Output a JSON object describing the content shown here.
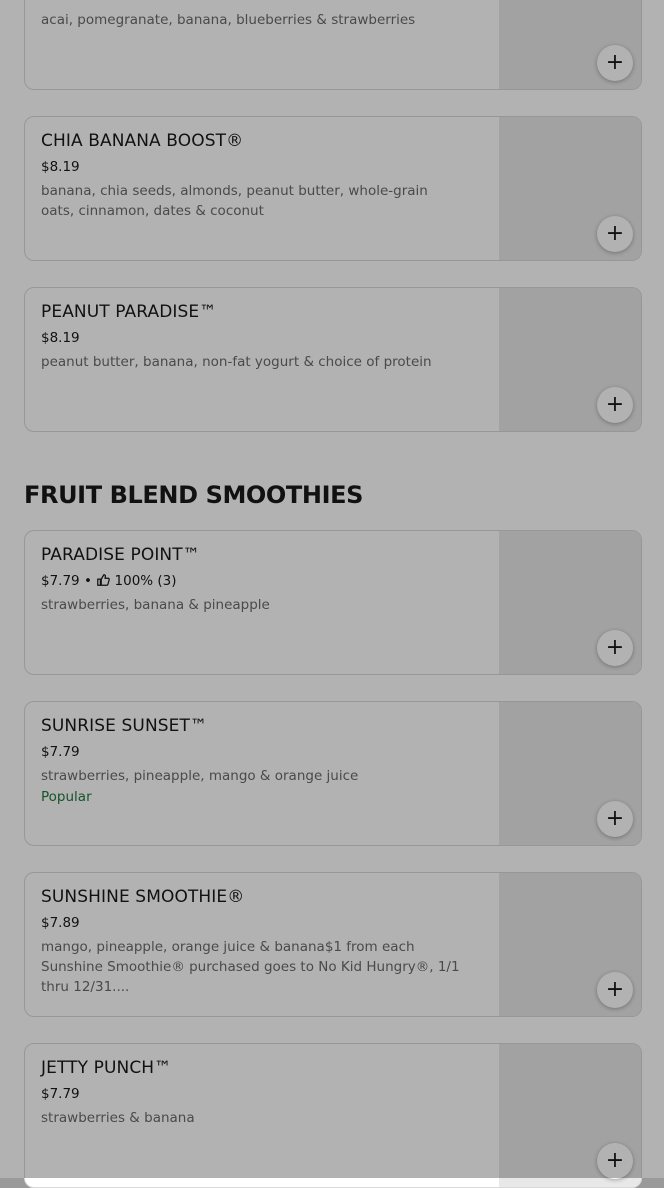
{
  "top_item": {
    "desc": "acai, pomegranate, banana, blueberries & strawberries"
  },
  "items_a": [
    {
      "name": "CHIA BANANA BOOST®",
      "price": "$8.19",
      "desc": "banana, chia seeds, almonds, peanut butter, whole-grain oats, cinnamon, dates & coconut"
    },
    {
      "name": "PEANUT PARADISE™",
      "price": "$8.19",
      "desc": "peanut butter, banana, non-fat yogurt & choice of protein"
    }
  ],
  "section": {
    "title": "FRUIT BLEND SMOOTHIES"
  },
  "items_b": [
    {
      "name": "PARADISE POINT™",
      "price": "$7.79",
      "rating_sep": "•",
      "rating": "100% (3)",
      "desc": "strawberries, banana & pineapple"
    },
    {
      "name": "SUNRISE SUNSET™",
      "price": "$7.79",
      "desc": "strawberries, pineapple, mango & orange juice",
      "tag": "Popular"
    },
    {
      "name": "SUNSHINE SMOOTHIE®",
      "price": "$7.89",
      "desc": "mango, pineapple, orange juice & banana$1 from each Sunshine Smoothie® purchased goes to No Kid Hungry®, 1/1 thru 12/31...."
    },
    {
      "name": "JETTY PUNCH™",
      "price": "$7.79",
      "desc": "strawberries & banana"
    }
  ],
  "add_label": "+",
  "icons": {
    "add": "plus-icon",
    "rating": "thumbs-up-icon"
  },
  "colors": {
    "popular": "#1f7a3d",
    "overlay": "rgba(0,0,0,0.30)"
  }
}
